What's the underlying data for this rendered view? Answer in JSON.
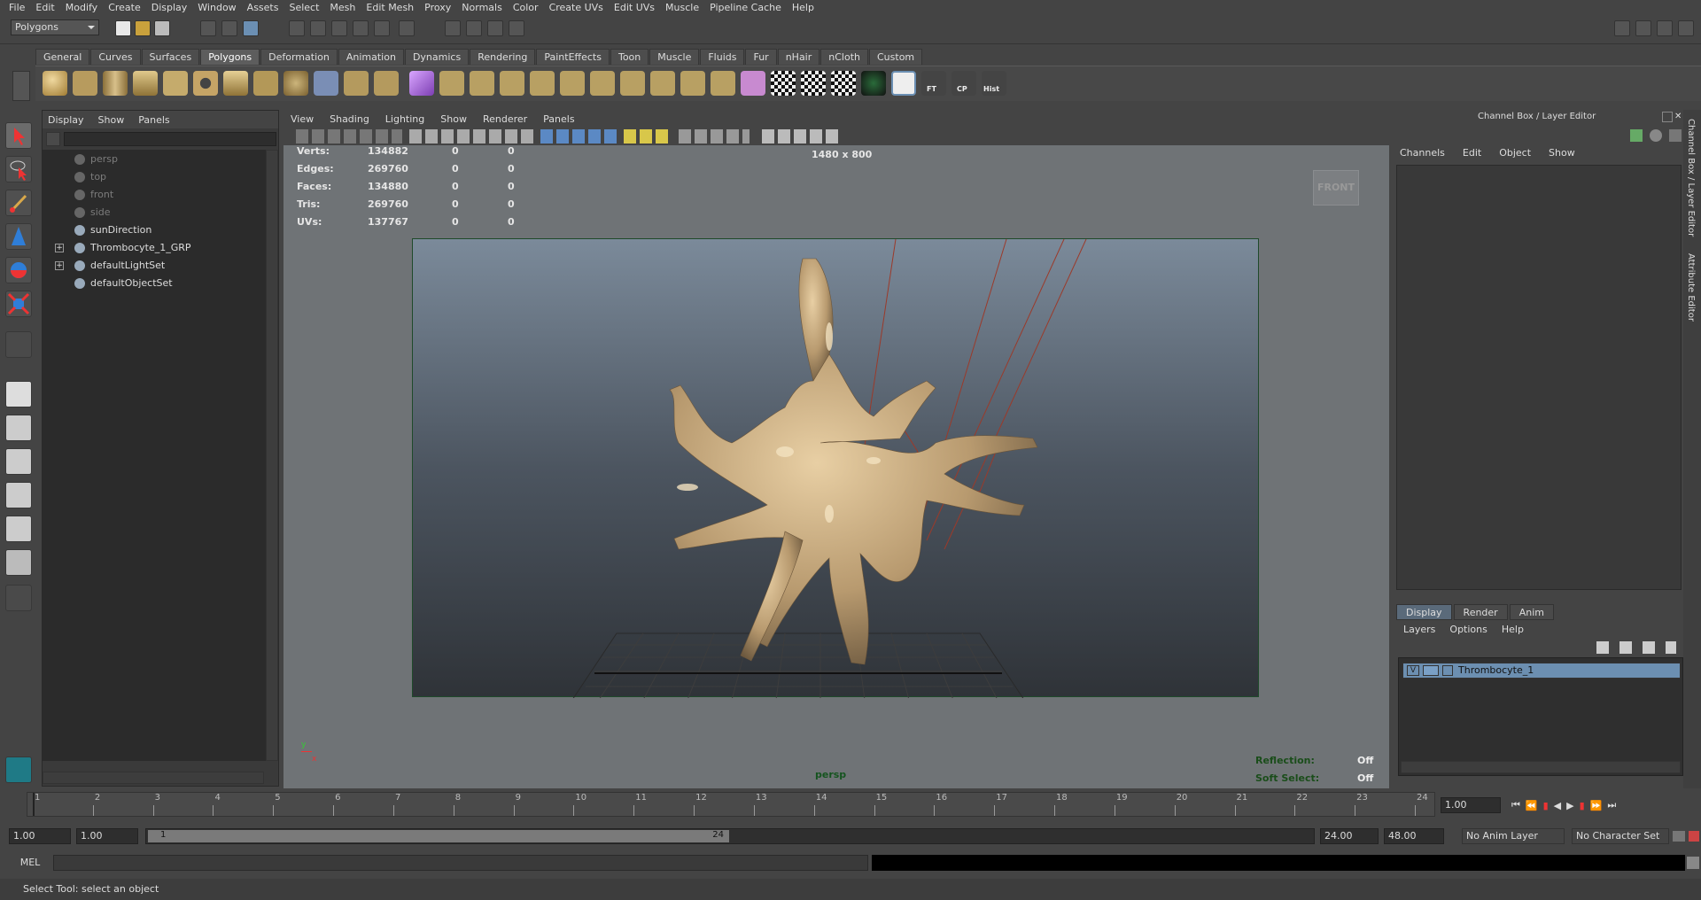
{
  "menubar": {
    "items": [
      "File",
      "Edit",
      "Modify",
      "Create",
      "Display",
      "Window",
      "Assets",
      "Select",
      "Mesh",
      "Edit Mesh",
      "Proxy",
      "Normals",
      "Color",
      "Create UVs",
      "Edit UVs",
      "Muscle",
      "Pipeline Cache",
      "Help"
    ]
  },
  "status": {
    "mode": "Polygons"
  },
  "shelf": {
    "tabs": [
      "General",
      "Curves",
      "Surfaces",
      "Polygons",
      "Deformation",
      "Animation",
      "Dynamics",
      "Rendering",
      "PaintEffects",
      "Toon",
      "Muscle",
      "Fluids",
      "Fur",
      "nHair",
      "nCloth",
      "Custom"
    ],
    "active": "Polygons",
    "labels": {
      "ft": "FT",
      "cp": "CP",
      "hist": "Hist"
    }
  },
  "outliner": {
    "menu": [
      "Display",
      "Show",
      "Panels"
    ],
    "items": [
      {
        "label": "persp",
        "dim": true
      },
      {
        "label": "top",
        "dim": true
      },
      {
        "label": "front",
        "dim": true
      },
      {
        "label": "side",
        "dim": true
      },
      {
        "label": "sunDirection",
        "dim": false
      },
      {
        "label": "Thrombocyte_1_GRP",
        "dim": false,
        "expand": "+"
      },
      {
        "label": "defaultLightSet",
        "dim": false,
        "expand": "+"
      },
      {
        "label": "defaultObjectSet",
        "dim": false
      }
    ]
  },
  "viewport": {
    "menu": [
      "View",
      "Shading",
      "Lighting",
      "Show",
      "Renderer",
      "Panels"
    ],
    "hud": [
      {
        "label": "Verts:",
        "a": "134882",
        "b": "0",
        "c": "0"
      },
      {
        "label": "Edges:",
        "a": "269760",
        "b": "0",
        "c": "0"
      },
      {
        "label": "Faces:",
        "a": "134880",
        "b": "0",
        "c": "0"
      },
      {
        "label": "Tris:",
        "a": "269760",
        "b": "0",
        "c": "0"
      },
      {
        "label": "UVs:",
        "a": "137767",
        "b": "0",
        "c": "0"
      }
    ],
    "resolution": "1480 x 800",
    "viewcube": "FRONT",
    "camera": "persp",
    "reflection_label": "Reflection:",
    "reflection_value": "Off",
    "softselect_label": "Soft Select:",
    "softselect_value": "Off",
    "axis_y": "y",
    "axis_x": "x"
  },
  "rightPanel": {
    "title": "Channel Box / Layer Editor",
    "menu": [
      "Channels",
      "Edit",
      "Object",
      "Show"
    ],
    "sideTabs": [
      "Channel Box / Layer Editor",
      "Attribute Editor"
    ],
    "layerTabs": [
      "Display",
      "Render",
      "Anim"
    ],
    "layerMenu": [
      "Layers",
      "Options",
      "Help"
    ],
    "layer": {
      "visible": "V",
      "name": "Thrombocyte_1"
    }
  },
  "timeline": {
    "ticks": [
      "1",
      "2",
      "3",
      "4",
      "5",
      "6",
      "7",
      "8",
      "9",
      "10",
      "11",
      "12",
      "13",
      "14",
      "15",
      "16",
      "17",
      "18",
      "19",
      "20",
      "21",
      "22",
      "23",
      "24"
    ],
    "current": "1.00"
  },
  "range": {
    "start": "1.00",
    "inner_start": "1.00",
    "slider_start": "1",
    "slider_end": "24",
    "end": "24.00",
    "outer_end": "48.00",
    "anim_layer": "No Anim Layer",
    "char_set": "No Character Set"
  },
  "command": {
    "label": "MEL"
  },
  "help": {
    "text": "Select Tool: select an object"
  }
}
